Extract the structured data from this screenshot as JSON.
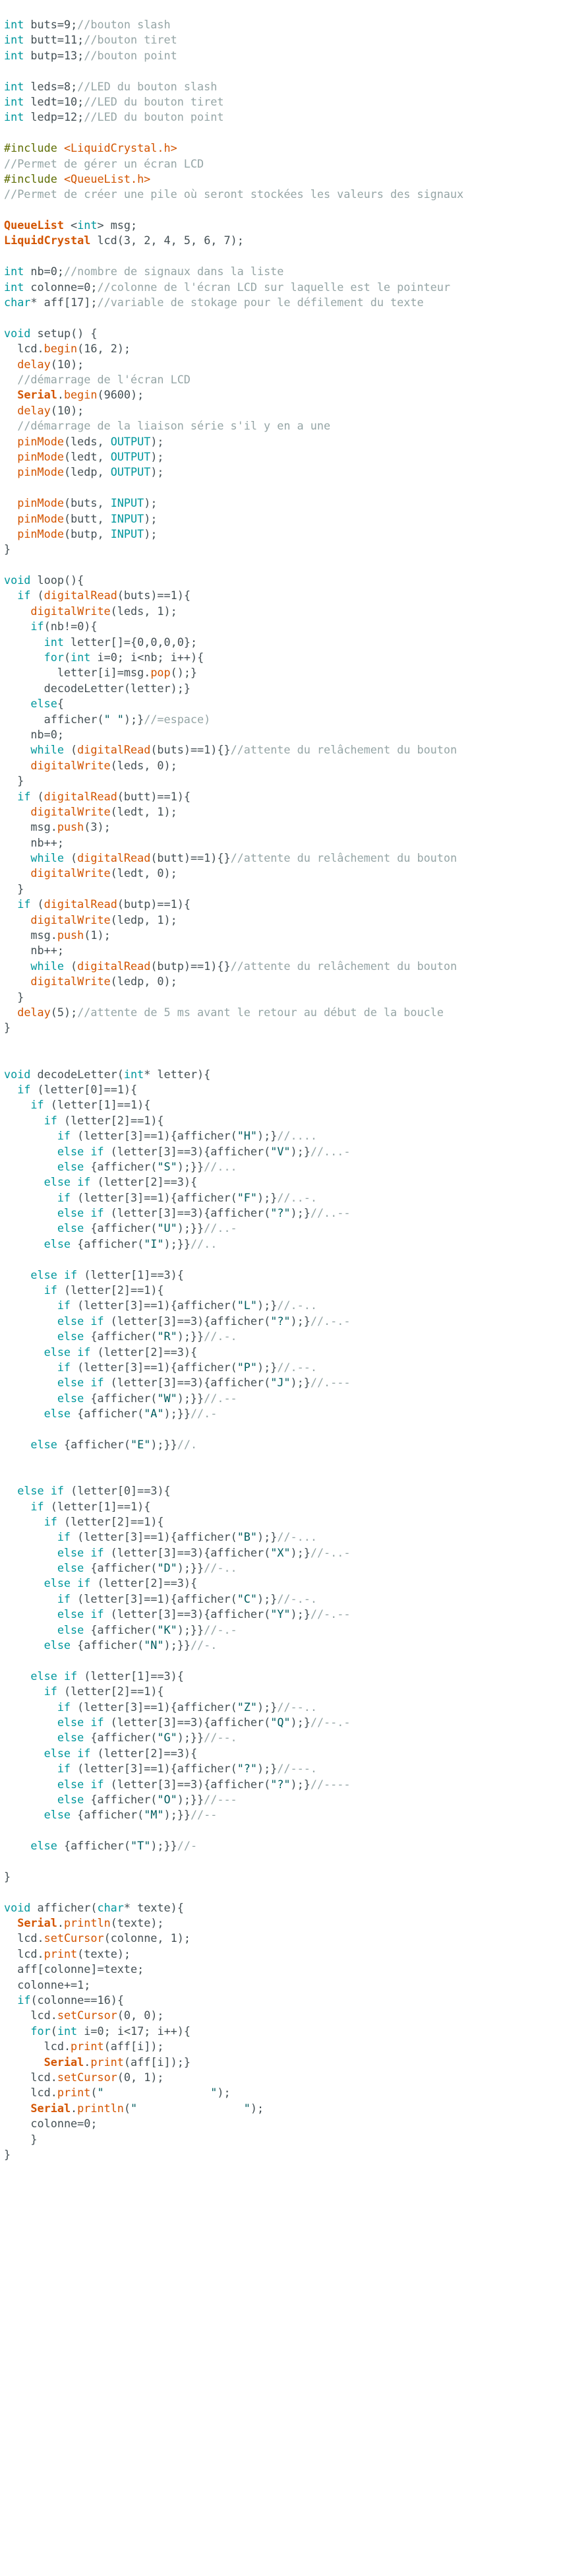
{
  "code_lines": [
    "int buts=9;//bouton slash",
    "int butt=11;//bouton tiret",
    "int butp=13;//bouton point",
    "",
    "int leds=8;//LED du bouton slash",
    "int ledt=10;//LED du bouton tiret",
    "int ledp=12;//LED du bouton point",
    "",
    "#include <LiquidCrystal.h>",
    "//Permet de gérer un écran LCD",
    "#include <QueueList.h>",
    "//Permet de créer une pile où seront stockées les valeurs des signaux",
    "",
    "QueueList <int> msg;",
    "LiquidCrystal lcd(3, 2, 4, 5, 6, 7);",
    "",
    "int nb=0;//nombre de signaux dans la liste",
    "int colonne=0;//colonne de l'écran LCD sur laquelle est le pointeur",
    "char* aff[17];//variable de stokage pour le défilement du texte",
    "",
    "void setup() {",
    "  lcd.begin(16, 2);",
    "  delay(10);",
    "  //démarrage de l'écran LCD",
    "  Serial.begin(9600);",
    "  delay(10);",
    "  //démarrage de la liaison série s'il y en a une",
    "  pinMode(leds, OUTPUT);",
    "  pinMode(ledt, OUTPUT);",
    "  pinMode(ledp, OUTPUT);",
    "",
    "  pinMode(buts, INPUT);",
    "  pinMode(butt, INPUT);",
    "  pinMode(butp, INPUT);",
    "}",
    "",
    "void loop(){",
    "  if (digitalRead(buts)==1){",
    "    digitalWrite(leds, 1);",
    "    if(nb!=0){",
    "      int letter[]={0,0,0,0};",
    "      for(int i=0; i<nb; i++){",
    "        letter[i]=msg.pop();}",
    "      decodeLetter(letter);}",
    "    else{",
    "      afficher(\" \");}//=espace)",
    "    nb=0;",
    "    while (digitalRead(buts)==1){}//attente du relâchement du bouton",
    "    digitalWrite(leds, 0);",
    "  }",
    "  if (digitalRead(butt)==1){",
    "    digitalWrite(ledt, 1);",
    "    msg.push(3);",
    "    nb++;",
    "    while (digitalRead(butt)==1){}//attente du relâchement du bouton",
    "    digitalWrite(ledt, 0);",
    "  }",
    "  if (digitalRead(butp)==1){",
    "    digitalWrite(ledp, 1);",
    "    msg.push(1);",
    "    nb++;",
    "    while (digitalRead(butp)==1){}//attente du relâchement du bouton",
    "    digitalWrite(ledp, 0);",
    "  }",
    "  delay(5);//attente de 5 ms avant le retour au début de la boucle",
    "}",
    "",
    "",
    "void decodeLetter(int* letter){",
    "  if (letter[0]==1){",
    "    if (letter[1]==1){",
    "      if (letter[2]==1){",
    "        if (letter[3]==1){afficher(\"H\");}//....",
    "        else if (letter[3]==3){afficher(\"V\");}//...-",
    "        else {afficher(\"S\");}}//...",
    "      else if (letter[2]==3){",
    "        if (letter[3]==1){afficher(\"F\");}//..-.",
    "        else if (letter[3]==3){afficher(\"?\");}//..--",
    "        else {afficher(\"U\");}}//..-",
    "      else {afficher(\"I\");}}//..",
    "",
    "    else if (letter[1]==3){",
    "      if (letter[2]==1){",
    "        if (letter[3]==1){afficher(\"L\");}//.-..",
    "        else if (letter[3]==3){afficher(\"?\");}//.-.-",
    "        else {afficher(\"R\");}}//.-.",
    "      else if (letter[2]==3){",
    "        if (letter[3]==1){afficher(\"P\");}//.--.",
    "        else if (letter[3]==3){afficher(\"J\");}//.---",
    "        else {afficher(\"W\");}}//.--",
    "      else {afficher(\"A\");}}//.-",
    "",
    "    else {afficher(\"E\");}}//.",
    "",
    "",
    "  else if (letter[0]==3){",
    "    if (letter[1]==1){",
    "      if (letter[2]==1){",
    "        if (letter[3]==1){afficher(\"B\");}//-...",
    "        else if (letter[3]==3){afficher(\"X\");}//-..-",
    "        else {afficher(\"D\");}}//-..",
    "      else if (letter[2]==3){",
    "        if (letter[3]==1){afficher(\"C\");}//-.-.",
    "        else if (letter[3]==3){afficher(\"Y\");}//-.--",
    "        else {afficher(\"K\");}}//-.-",
    "      else {afficher(\"N\");}}//-.",
    "",
    "    else if (letter[1]==3){",
    "      if (letter[2]==1){",
    "        if (letter[3]==1){afficher(\"Z\");}//--..",
    "        else if (letter[3]==3){afficher(\"Q\");}//--.-",
    "        else {afficher(\"G\");}}//--.",
    "      else if (letter[2]==3){",
    "        if (letter[3]==1){afficher(\"?\");}//---.",
    "        else if (letter[3]==3){afficher(\"?\");}//----",
    "        else {afficher(\"O\");}}//---",
    "      else {afficher(\"M\");}}//--",
    "",
    "    else {afficher(\"T\");}}//-",
    "",
    "}",
    "",
    "void afficher(char* texte){",
    "  Serial.println(texte);",
    "  lcd.setCursor(colonne, 1);",
    "  lcd.print(texte);",
    "  aff[colonne]=texte;",
    "  colonne+=1;",
    "  if(colonne==16){",
    "    lcd.setCursor(0, 0);",
    "    for(int i=0; i<17; i++){",
    "      lcd.print(aff[i]);",
    "      Serial.print(aff[i]);}",
    "    lcd.setCursor(0, 1);",
    "    lcd.print(\"                \");",
    "    Serial.println(\"                \");",
    "    colonne=0;",
    "    }",
    "}"
  ],
  "colors": {
    "background": "#ffffff",
    "text": "#434f54",
    "keyword": "#00979d",
    "function": "#d35400",
    "comment": "#95a5a6",
    "string": "#005c5f",
    "preprocessor": "#5e6d03"
  }
}
